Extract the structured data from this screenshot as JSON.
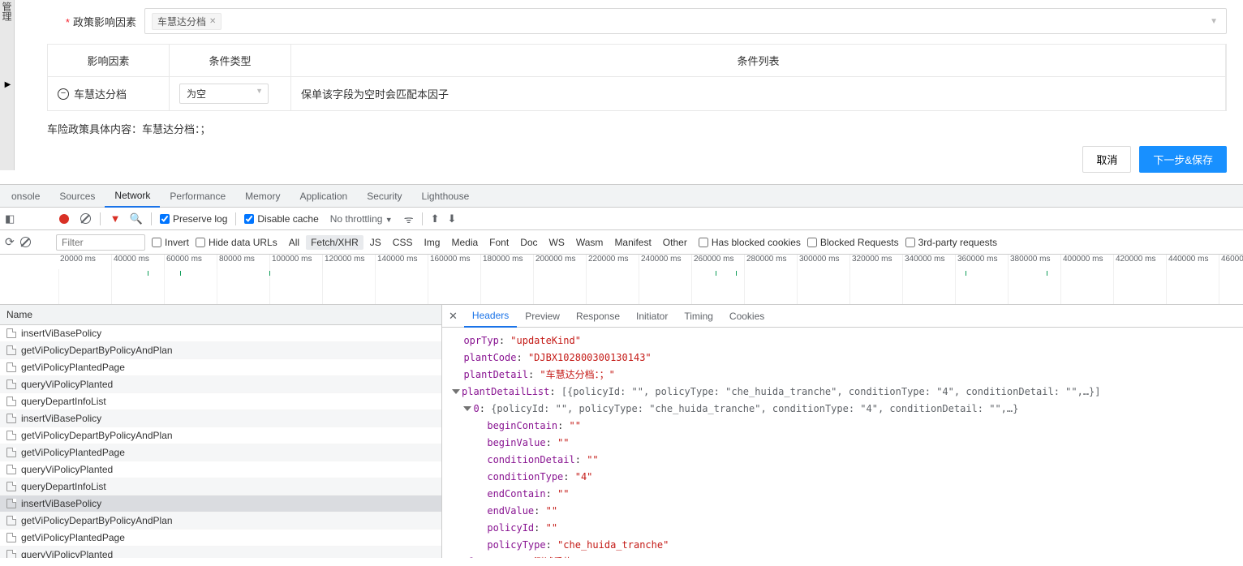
{
  "leftPanelLabel": "管理",
  "form": {
    "policyFactorLabel": "政策影响因素",
    "chipText": "车慧达分档"
  },
  "table": {
    "headers": {
      "col1": "影响因素",
      "col2": "条件类型",
      "col3": "条件列表"
    },
    "row": {
      "factor": "车慧达分档",
      "condSelect": "为空",
      "condText": "保单该字段为空时会匹配本因子"
    }
  },
  "summary": "车险政策具体内容：车慧达分档：；",
  "buttons": {
    "cancel": "取消",
    "next": "下一步&保存"
  },
  "devtools": {
    "tabs": [
      "onsole",
      "Sources",
      "Network",
      "Performance",
      "Memory",
      "Application",
      "Security",
      "Lighthouse"
    ],
    "activeTab": "Network",
    "toolbar": {
      "preserveLog": "Preserve log",
      "disableCache": "Disable cache",
      "throttling": "No throttling"
    },
    "filterBar": {
      "filterPlaceholder": "Filter",
      "invert": "Invert",
      "hideData": "Hide data URLs",
      "types": [
        "All",
        "Fetch/XHR",
        "JS",
        "CSS",
        "Img",
        "Media",
        "Font",
        "Doc",
        "WS",
        "Wasm",
        "Manifest",
        "Other"
      ],
      "selectedType": "Fetch/XHR",
      "hasBlocked": "Has blocked cookies",
      "blockedReq": "Blocked Requests",
      "thirdParty": "3rd-party requests"
    },
    "timelineTicks": [
      "20000 ms",
      "40000 ms",
      "60000 ms",
      "80000 ms",
      "100000 ms",
      "120000 ms",
      "140000 ms",
      "160000 ms",
      "180000 ms",
      "200000 ms",
      "220000 ms",
      "240000 ms",
      "260000 ms",
      "280000 ms",
      "300000 ms",
      "320000 ms",
      "340000 ms",
      "360000 ms",
      "380000 ms",
      "400000 ms",
      "420000 ms",
      "440000 ms",
      "46000"
    ],
    "nameHeader": "Name",
    "requests": [
      "insertViBasePolicy",
      "getViPolicyDepartByPolicyAndPlan",
      "getViPolicyPlantedPage",
      "queryViPolicyPlanted",
      "queryDepartInfoList",
      "insertViBasePolicy",
      "getViPolicyDepartByPolicyAndPlan",
      "getViPolicyPlantedPage",
      "queryViPolicyPlanted",
      "queryDepartInfoList",
      "insertViBasePolicy",
      "getViPolicyDepartByPolicyAndPlan",
      "getViPolicyPlantedPage",
      "queryViPolicyPlanted"
    ],
    "selectedRequestIndex": 10,
    "detailTabs": [
      "Headers",
      "Preview",
      "Response",
      "Initiator",
      "Timing",
      "Cookies"
    ],
    "activeDetailTab": "Headers",
    "json": {
      "oprTyp": "updateKind",
      "plantCode": "DJBX102800300130143",
      "plantDetail": "车慧达分档：；",
      "plantDetailListSummary": "[{policyId: \"\", policyType: \"che_huida_tranche\", conditionType: \"4\", conditionDetail: \"\",…}]",
      "item0Summary": "{policyId: \"\", policyType: \"che_huida_tranche\", conditionType: \"4\", conditionDetail: \"\",…}",
      "fields": {
        "beginContain": "\"\"",
        "beginValue": "\"\"",
        "conditionDetail": "\"\"",
        "conditionType": "\"4\"",
        "endContain": "\"\"",
        "endValue": "\"\"",
        "policyId": "\"\"",
        "policyType": "\"che_huida_tranche\""
      },
      "plantName": "测试重构"
    }
  }
}
